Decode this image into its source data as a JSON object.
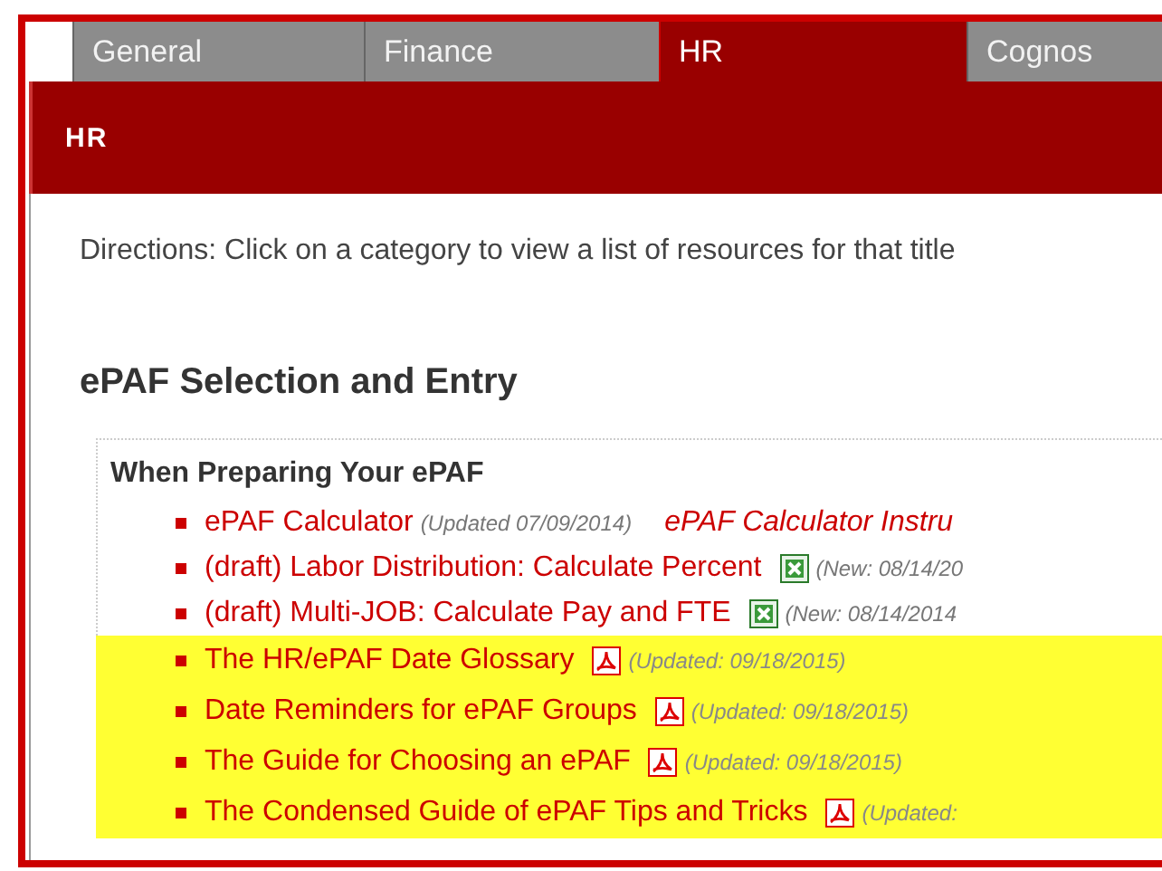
{
  "tabs": [
    {
      "label": "General",
      "selected": false
    },
    {
      "label": "Finance",
      "selected": false
    },
    {
      "label": "HR",
      "selected": true
    },
    {
      "label": "Cognos",
      "selected": false
    }
  ],
  "header": {
    "title": "HR"
  },
  "directions": "Directions: Click on a category to view a list of resources for that title",
  "section": {
    "title": "ePAF Selection and Entry",
    "group": {
      "title": "When Preparing Your ePAF",
      "items": [
        {
          "title": "ePAF Calculator",
          "kind": "link",
          "note": "(Updated 07/09/2014)",
          "extra": "ePAF Calculator Instru",
          "highlighted": false
        },
        {
          "title": "(draft) Labor Distribution: Calculate Percent",
          "kind": "spreadsheet",
          "note": "(New: 08/14/20",
          "highlighted": false
        },
        {
          "title": "(draft) Multi-JOB: Calculate Pay and FTE",
          "kind": "spreadsheet",
          "note": "(New: 08/14/2014",
          "highlighted": false
        },
        {
          "title": "The HR/ePAF Date Glossary",
          "kind": "pdf",
          "note": "(Updated: 09/18/2015)",
          "highlighted": true
        },
        {
          "title": "Date Reminders for ePAF Groups",
          "kind": "pdf",
          "note": "(Updated: 09/18/2015)",
          "highlighted": true
        },
        {
          "title": "The Guide for Choosing an ePAF",
          "kind": "pdf",
          "note": "(Updated: 09/18/2015)",
          "highlighted": true
        },
        {
          "title": "The Condensed Guide of ePAF Tips and Tricks",
          "kind": "pdf",
          "note": "(Updated:",
          "highlighted": true
        }
      ]
    }
  }
}
